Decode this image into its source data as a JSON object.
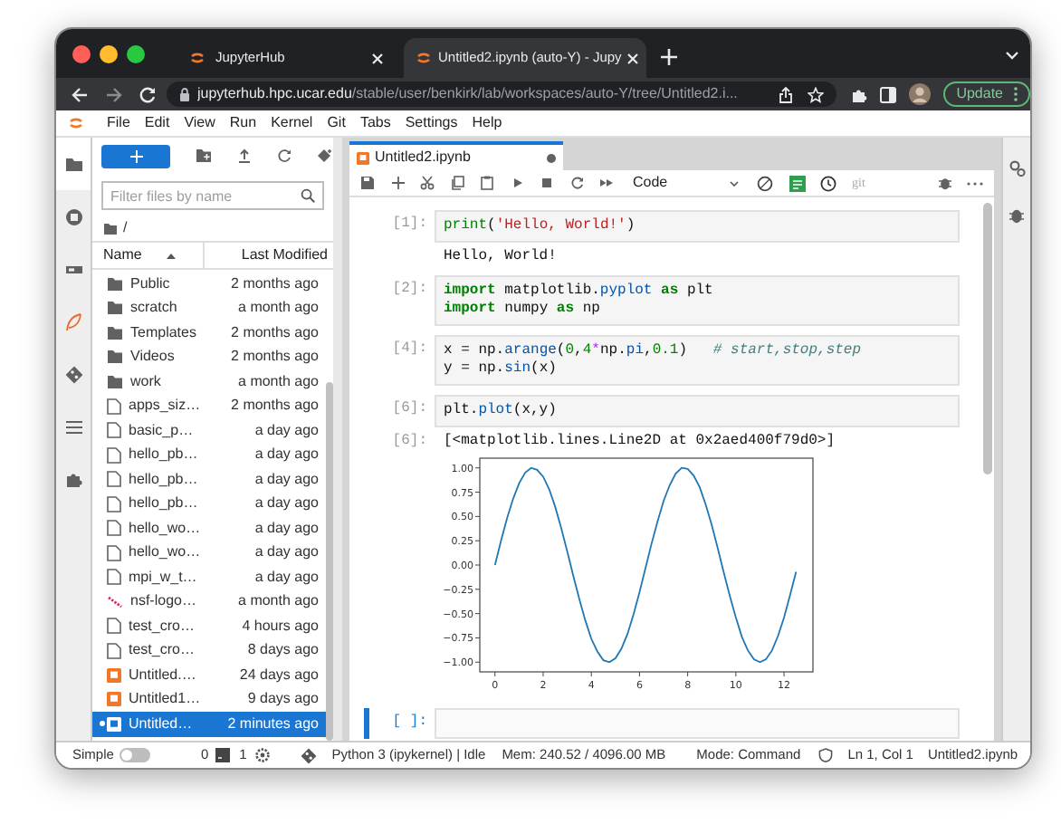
{
  "browser": {
    "tabs": [
      {
        "title": "JupyterHub",
        "selected": false
      },
      {
        "title": "Untitled2.ipynb (auto-Y) - Jupy",
        "selected": true
      }
    ],
    "url": {
      "host": "jupyterhub.hpc.ucar.edu",
      "path": "/stable/user/benkirk/lab/workspaces/auto-Y/tree/Untitled2.i..."
    },
    "update_button": "Update"
  },
  "menu": [
    "File",
    "Edit",
    "View",
    "Run",
    "Kernel",
    "Git",
    "Tabs",
    "Settings",
    "Help"
  ],
  "file_browser": {
    "filter": {
      "placeholder": "Filter files by name"
    },
    "path": "/",
    "columns": [
      "Name",
      "Last Modified"
    ],
    "rows": [
      {
        "name": "Public",
        "modified": "2 months ago",
        "kind": "folder",
        "selected": false,
        "running": false
      },
      {
        "name": "scratch",
        "modified": "a month ago",
        "kind": "folder",
        "selected": false,
        "running": false
      },
      {
        "name": "Templates",
        "modified": "2 months ago",
        "kind": "folder",
        "selected": false,
        "running": false
      },
      {
        "name": "Videos",
        "modified": "2 months ago",
        "kind": "folder",
        "selected": false,
        "running": false
      },
      {
        "name": "work",
        "modified": "a month ago",
        "kind": "folder",
        "selected": false,
        "running": false
      },
      {
        "name": "apps_siz…",
        "modified": "2 months ago",
        "kind": "file",
        "selected": false,
        "running": false
      },
      {
        "name": "basic_p…",
        "modified": "a day ago",
        "kind": "file",
        "selected": false,
        "running": false
      },
      {
        "name": "hello_pb…",
        "modified": "a day ago",
        "kind": "file",
        "selected": false,
        "running": false
      },
      {
        "name": "hello_pb…",
        "modified": "a day ago",
        "kind": "file",
        "selected": false,
        "running": false
      },
      {
        "name": "hello_pb…",
        "modified": "a day ago",
        "kind": "file",
        "selected": false,
        "running": false
      },
      {
        "name": "hello_wo…",
        "modified": "a day ago",
        "kind": "file",
        "selected": false,
        "running": false
      },
      {
        "name": "hello_wo…",
        "modified": "a day ago",
        "kind": "file",
        "selected": false,
        "running": false
      },
      {
        "name": "mpi_w_t…",
        "modified": "a day ago",
        "kind": "file",
        "selected": false,
        "running": false
      },
      {
        "name": "nsf-logo…",
        "modified": "a month ago",
        "kind": "image",
        "selected": false,
        "running": false
      },
      {
        "name": "test_cro…",
        "modified": "4 hours ago",
        "kind": "file",
        "selected": false,
        "running": false
      },
      {
        "name": "test_cro…",
        "modified": "8 days ago",
        "kind": "file",
        "selected": false,
        "running": false
      },
      {
        "name": "Untitled.…",
        "modified": "24 days ago",
        "kind": "notebook",
        "selected": false,
        "running": false
      },
      {
        "name": "Untitled1…",
        "modified": "9 days ago",
        "kind": "notebook",
        "selected": false,
        "running": false
      },
      {
        "name": "Untitled…",
        "modified": "2 minutes ago",
        "kind": "notebook",
        "selected": true,
        "running": true
      }
    ]
  },
  "notebook": {
    "tab": {
      "title": "Untitled2.ipynb",
      "modified": true
    },
    "cell_type": "Code",
    "git": "git",
    "cells": [
      {
        "prompt": "[1]:",
        "active": false,
        "lines": [
          [
            {
              "kind": "builtin",
              "text": "print"
            },
            {
              "kind": "plain",
              "text": "("
            },
            {
              "kind": "string",
              "text": "'Hello, World!'"
            },
            {
              "kind": "plain",
              "text": ")"
            }
          ]
        ],
        "outputs": [
          {
            "kind": "text",
            "text": "Hello, World!"
          }
        ]
      },
      {
        "prompt": "[2]:",
        "active": false,
        "lines": [
          [
            {
              "kind": "keyword",
              "text": "import"
            },
            {
              "kind": "plain",
              "text": " matplotlib."
            },
            {
              "kind": "attr",
              "text": "pyplot"
            },
            {
              "kind": "keyword",
              "text": " as"
            },
            {
              "kind": "plain",
              "text": " plt"
            }
          ],
          [
            {
              "kind": "keyword",
              "text": "import"
            },
            {
              "kind": "plain",
              "text": " numpy "
            },
            {
              "kind": "keyword",
              "text": "as"
            },
            {
              "kind": "plain",
              "text": " np"
            }
          ]
        ]
      },
      {
        "prompt": "[4]:",
        "active": false,
        "lines": [
          [
            {
              "kind": "plain",
              "text": "x = np."
            },
            {
              "kind": "attr",
              "text": "arange"
            },
            {
              "kind": "plain",
              "text": "("
            },
            {
              "kind": "number",
              "text": "0"
            },
            {
              "kind": "plain",
              "text": ","
            },
            {
              "kind": "number",
              "text": "4"
            },
            {
              "kind": "operator",
              "text": "*"
            },
            {
              "kind": "plain",
              "text": "np."
            },
            {
              "kind": "attr",
              "text": "pi"
            },
            {
              "kind": "plain",
              "text": ","
            },
            {
              "kind": "number",
              "text": "0.1"
            },
            {
              "kind": "plain",
              "text": ")   "
            },
            {
              "kind": "comment",
              "text": "# start,stop,step"
            }
          ],
          [
            {
              "kind": "plain",
              "text": "y = np."
            },
            {
              "kind": "attr",
              "text": "sin"
            },
            {
              "kind": "plain",
              "text": "(x)"
            }
          ]
        ]
      },
      {
        "prompt": "[6]:",
        "active": false,
        "lines": [
          [
            {
              "kind": "plain",
              "text": "plt."
            },
            {
              "kind": "attr",
              "text": "plot"
            },
            {
              "kind": "plain",
              "text": "(x,y)"
            }
          ]
        ],
        "outputs": [
          {
            "kind": "text",
            "prompt": "[6]:",
            "text": "[<matplotlib.lines.Line2D at 0x2aed400f79d0>]"
          },
          {
            "kind": "chart",
            "chart_data": {
              "type": "line",
              "x": [
                0,
                0.25,
                0.5,
                0.75,
                1,
                1.25,
                1.5,
                1.75,
                2,
                2.25,
                2.5,
                2.75,
                3,
                3.25,
                3.5,
                3.75,
                4,
                4.25,
                4.5,
                4.75,
                5,
                5.25,
                5.5,
                5.75,
                6,
                6.25,
                6.5,
                6.75,
                7,
                7.25,
                7.5,
                7.75,
                8,
                8.25,
                8.5,
                8.75,
                9,
                9.25,
                9.5,
                9.75,
                10,
                10.25,
                10.5,
                10.75,
                11,
                11.25,
                11.5,
                11.75,
                12,
                12.25,
                12.5
              ],
              "series": [
                {
                  "color": "#1f77b4",
                  "values": [
                    0,
                    0.25,
                    0.48,
                    0.68,
                    0.84,
                    0.95,
                    1,
                    0.98,
                    0.91,
                    0.78,
                    0.6,
                    0.38,
                    0.14,
                    -0.11,
                    -0.35,
                    -0.57,
                    -0.76,
                    -0.89,
                    -0.98,
                    -1,
                    -0.96,
                    -0.86,
                    -0.71,
                    -0.51,
                    -0.28,
                    -0.03,
                    0.22,
                    0.45,
                    0.66,
                    0.82,
                    0.94,
                    1,
                    0.99,
                    0.92,
                    0.8,
                    0.62,
                    0.41,
                    0.17,
                    -0.08,
                    -0.32,
                    -0.54,
                    -0.74,
                    -0.88,
                    -0.97,
                    -1,
                    -0.97,
                    -0.88,
                    -0.73,
                    -0.54,
                    -0.31,
                    -0.07
                  ]
                }
              ],
              "xlim": [
                -0.63,
                13.2
              ],
              "ylim": [
                -1.1,
                1.1
              ],
              "xticks": [
                0,
                2,
                4,
                6,
                8,
                10,
                12
              ],
              "yticks": [
                {
                  "value": 1,
                  "label": "1.00"
                },
                {
                  "value": 0.75,
                  "label": "0.75"
                },
                {
                  "value": 0.5,
                  "label": "0.50"
                },
                {
                  "value": 0.25,
                  "label": "0.25"
                },
                {
                  "value": 0,
                  "label": "0.00"
                },
                {
                  "value": -0.25,
                  "label": "−0.25"
                },
                {
                  "value": -0.5,
                  "label": "−0.50"
                },
                {
                  "value": -0.75,
                  "label": "−0.75"
                },
                {
                  "value": -1,
                  "label": "−1.00"
                }
              ]
            }
          }
        ]
      },
      {
        "prompt": "[ ]:",
        "active": true
      }
    ]
  },
  "status_bar": {
    "mode_label": "Simple",
    "simple_on": false,
    "terminals": "0",
    "kernels": "1",
    "kernel": "Python 3 (ipykernel) | Idle",
    "memory": "Mem: 240.52 / 4096.00 MB",
    "mode": "Mode: Command",
    "position": "Ln 1, Col 1",
    "file": "Untitled2.ipynb"
  }
}
